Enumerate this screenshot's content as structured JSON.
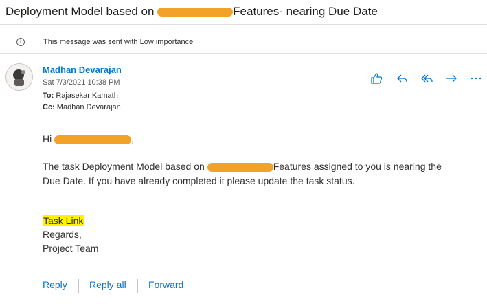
{
  "subject": {
    "prefix": "Deployment Model based on",
    "suffix": "Features- nearing Due Date"
  },
  "notice": {
    "icon": "info-icon",
    "text": "This message was sent with Low importance"
  },
  "sender": {
    "name": "Madhan Devarajan",
    "date": "Sat 7/3/2021 10:38 PM",
    "to_label": "To:",
    "to_value": "Rajasekar Kamath",
    "cc_label": "Cc:",
    "cc_value": "Madhan Devarajan"
  },
  "message": {
    "greeting": "Hi",
    "greeting_end": ",",
    "line1_prefix": "The task Deployment Model based on",
    "line1_suffix": "Features assigned to you is nearing the",
    "line2": "Due Date. If you have already completed it please update the task status.",
    "link": "Task Link",
    "regards": "Regards,",
    "team": "Project Team"
  },
  "actions": [
    "like-icon",
    "reply-icon",
    "reply-all-icon",
    "forward-icon",
    "more-icon"
  ],
  "footer": {
    "reply": "Reply",
    "reply_all": "Reply all",
    "forward": "Forward"
  },
  "colors": {
    "accent": "#0078d4",
    "redaction": "#f2a229",
    "highlight": "#fff200"
  }
}
